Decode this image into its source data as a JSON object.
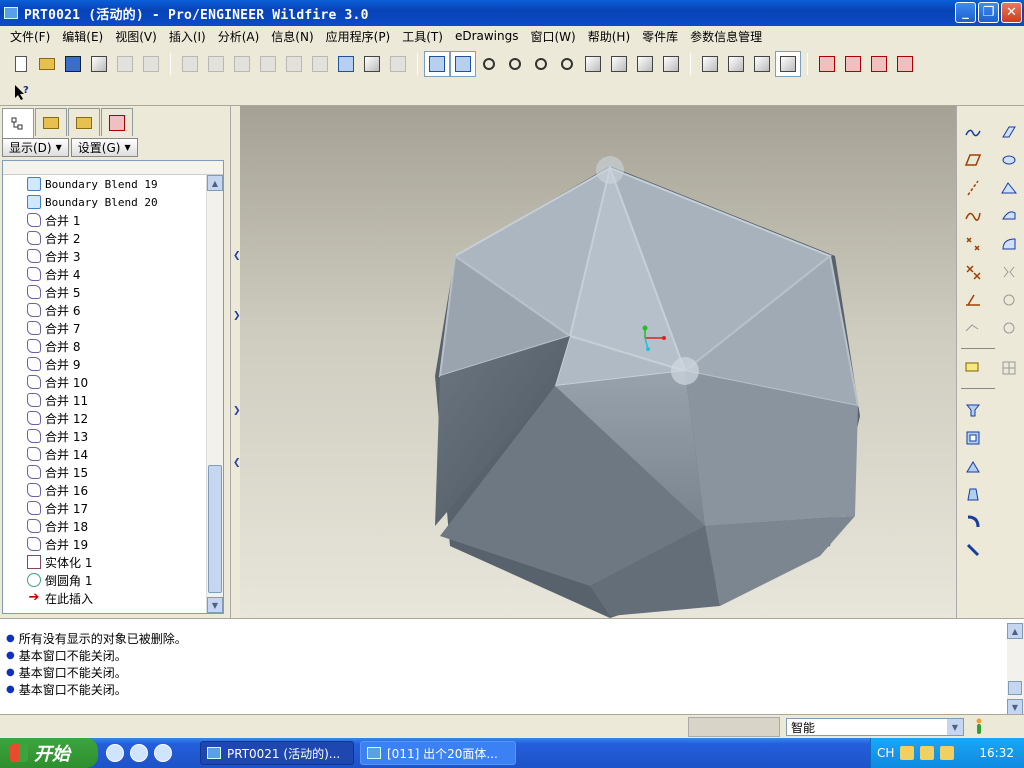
{
  "window": {
    "title": "PRT0021 (活动的) - Pro/ENGINEER Wildfire 3.0",
    "buttons": {
      "minimize": "_",
      "maximize": "❐",
      "close": "✕"
    }
  },
  "menubar": {
    "items": [
      "文件(F)",
      "编辑(E)",
      "视图(V)",
      "插入(I)",
      "分析(A)",
      "信息(N)",
      "应用程序(P)",
      "工具(T)",
      "eDrawings",
      "窗口(W)",
      "帮助(H)",
      "零件库",
      "参数信息管理"
    ]
  },
  "model_tree": {
    "display_button": "显示(D)",
    "settings_button": "设置(G)",
    "items": [
      {
        "label": "Boundary Blend 19",
        "type": "blend"
      },
      {
        "label": "Boundary Blend 20",
        "type": "blend"
      },
      {
        "label": "合并 1",
        "type": "merge"
      },
      {
        "label": "合并 2",
        "type": "merge"
      },
      {
        "label": "合并 3",
        "type": "merge"
      },
      {
        "label": "合并 4",
        "type": "merge"
      },
      {
        "label": "合并 5",
        "type": "merge"
      },
      {
        "label": "合并 6",
        "type": "merge"
      },
      {
        "label": "合并 7",
        "type": "merge"
      },
      {
        "label": "合并 8",
        "type": "merge"
      },
      {
        "label": "合并 9",
        "type": "merge"
      },
      {
        "label": "合并 10",
        "type": "merge"
      },
      {
        "label": "合并 11",
        "type": "merge"
      },
      {
        "label": "合并 12",
        "type": "merge"
      },
      {
        "label": "合并 13",
        "type": "merge"
      },
      {
        "label": "合并 14",
        "type": "merge"
      },
      {
        "label": "合并 15",
        "type": "merge"
      },
      {
        "label": "合并 16",
        "type": "merge"
      },
      {
        "label": "合并 17",
        "type": "merge"
      },
      {
        "label": "合并 18",
        "type": "merge"
      },
      {
        "label": "合并 19",
        "type": "merge"
      },
      {
        "label": "实体化 1",
        "type": "solid"
      },
      {
        "label": "倒圆角 1",
        "type": "round"
      },
      {
        "label": "在此插入",
        "type": "insert"
      }
    ]
  },
  "messages": [
    "所有没有显示的对象已被删除。",
    "基本窗口不能关闭。",
    "基本窗口不能关闭。",
    "基本窗口不能关闭。"
  ],
  "statusbar": {
    "filter_value": "智能"
  },
  "taskbar": {
    "start_label": "开始",
    "tasks": [
      {
        "label": "PRT0021 (活动的)...",
        "active": true
      },
      {
        "label": "[011] 出个20面体...",
        "active": false
      }
    ],
    "tray_lang": "CH",
    "clock": "16:32"
  },
  "colors": {
    "title_bar": "#0842b6",
    "model_light": "#b4bec8",
    "model_dark": "#5c6670",
    "background_top": "#a5a295",
    "background_bottom": "#e8e6da"
  }
}
